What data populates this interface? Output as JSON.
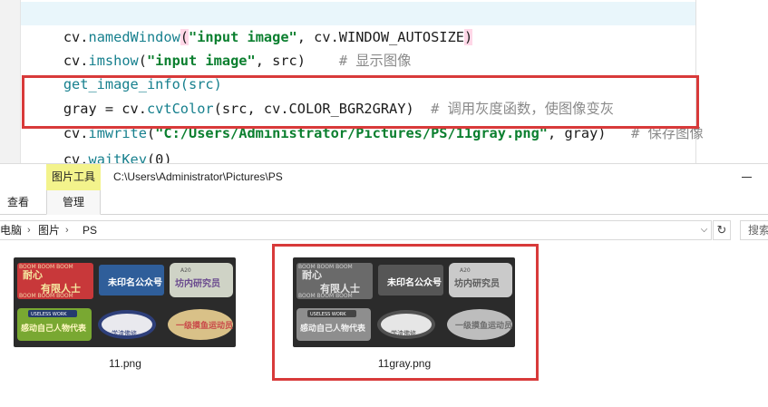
{
  "code": {
    "line1": {
      "obj": "cv.",
      "fn": "namedWindow",
      "open": "(",
      "str": "\"input image\"",
      "rest": ", cv.WINDOW_AUTOSIZE",
      "close": ")"
    },
    "line2": {
      "obj": "cv.",
      "fn": "imshow",
      "open": "(",
      "str": "\"input image\"",
      "rest": ", src)",
      "comment": "# 显示图像"
    },
    "line3": {
      "text": "get_image_info(src)"
    },
    "line4": {
      "pre": "gray = cv.",
      "fn": "cvtColor",
      "rest": "(src, cv.COLOR_BGR2GRAY)",
      "comment": "# 调用灰度函数，使图像变灰"
    },
    "line5": {
      "obj": "cv.",
      "fn": "imwrite",
      "open": "(",
      "str": "\"C:/Users/Administrator/Pictures/PS/11gray.png\"",
      "rest": ", gray)",
      "comment": "# 保存图像"
    },
    "line6": {
      "obj": "cv.",
      "fn": "waitKey",
      "rest": "(0)"
    }
  },
  "explorer": {
    "context_tab": "图片工具",
    "title_path": "C:\\Users\\Administrator\\Pictures\\PS",
    "tabs": {
      "view": "查看",
      "manage": "管理"
    },
    "breadcrumb": [
      "电脑",
      "图片",
      "PS"
    ],
    "search_placeholder": "搜索"
  },
  "files": [
    {
      "name": "11.png",
      "grayscale": false
    },
    {
      "name": "11gray.png",
      "grayscale": true
    }
  ],
  "thumbnail_text": {
    "badge1_a": "耐心",
    "badge1_b": "有限人士",
    "boom": "BOOM BOOM BOOM",
    "badge2": "未印名公众号",
    "badge3": "坊内研究员",
    "badge3_top": "A20",
    "badge4_top": "USELESS WORK",
    "badge4": "感动自己人物代表",
    "badge5": "学渣佛修",
    "badge6": "一级摸鱼运动员"
  },
  "colors": {
    "accent_red": "#d83a3a",
    "context_tab": "#f3f38c"
  }
}
